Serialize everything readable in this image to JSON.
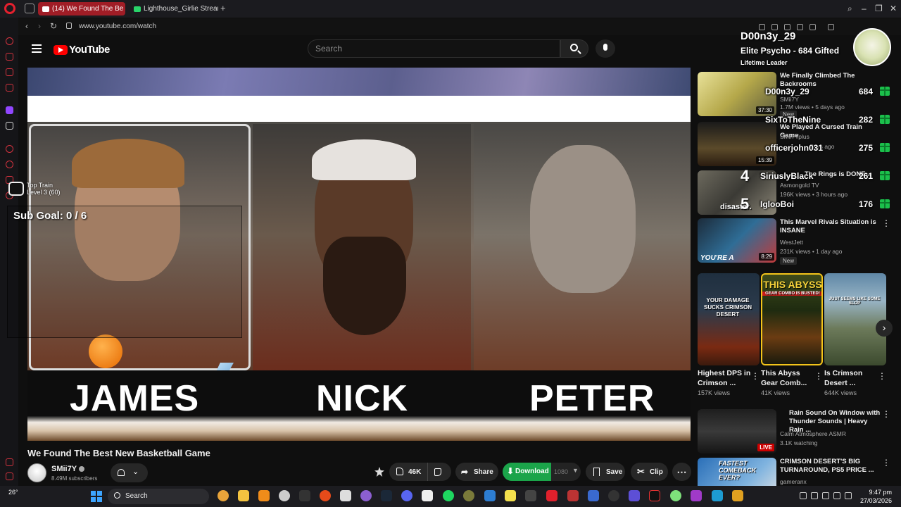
{
  "browser": {
    "tabs": [
      {
        "label": "(14) We Found The Be",
        "active": true
      },
      {
        "label": "Lighthouse_Girlie Stream",
        "active": false
      }
    ],
    "url": "www.youtube.com/watch"
  },
  "youtube": {
    "logo_text": "YouTube",
    "search_placeholder": "Search"
  },
  "video": {
    "title": "We Found The Best New Basketball Game",
    "players": [
      "JAMES",
      "NICK",
      "PETER"
    ],
    "overlay": {
      "train_title": "Top Train",
      "train_level": "Level 3 (60)",
      "sub_goal": "Sub Goal: 0 / 6"
    }
  },
  "channel": {
    "name": "SMii7Y",
    "subscribers": "8.49M subscribers"
  },
  "actions": {
    "likes": "46K",
    "share": "Share",
    "download": "Download",
    "resolution": "1080",
    "save": "Save",
    "clip": "Clip"
  },
  "leaderboard": {
    "top_user": "D00n3y_29",
    "top_title": "Elite Psycho - 684 Gifted",
    "top_subtitle": "Lifetime Leader",
    "entries": [
      {
        "rank": "",
        "user": "D00n3y_29",
        "value": "684"
      },
      {
        "rank": "",
        "user": "SixToTheNine",
        "value": "282"
      },
      {
        "rank": "",
        "user": "officerjohn031",
        "value": "275"
      },
      {
        "rank": "4",
        "user": "SiriuslyBlack",
        "value": "261"
      },
      {
        "rank": "5",
        "user": "IglooBoi",
        "value": "176"
      }
    ]
  },
  "recommendations": [
    {
      "title": "We Finally Climbed The Backrooms",
      "channel": "SMii7Y",
      "meta": "1.7M views • 5 days ago",
      "duration": "37:30",
      "badge": "New"
    },
    {
      "title": "We Played A Cursed Train Game",
      "channel": "SMii7Yplus",
      "meta": "days ago",
      "duration": "15:39",
      "badge": ""
    },
    {
      "title": "The Rings is DONE...",
      "channel": "Asmongold TV",
      "meta": "196K views • 3 hours ago",
      "duration": "",
      "badge": ""
    },
    {
      "title": "This Marvel Rivals Situation is INSANE",
      "channel": "WestJett",
      "meta": "231K views • 1 day ago",
      "duration": "8:29",
      "badge": "New"
    },
    {
      "title": "Rain Sound On Window with Thunder Sounds | Heavy Rain ...",
      "channel": "Calm Atmosphere ASMR",
      "meta": "3.1K watching",
      "duration": "",
      "live": "LIVE",
      "badge": ""
    },
    {
      "title": "CRIMSON DESERT'S BIG TURNAROUND, PS5 PRICE ...",
      "channel": "gameranx",
      "meta": "",
      "duration": "",
      "badge": ""
    }
  ],
  "thumb_captions": {
    "rec1": "disaster.",
    "rec4": "YOU'RE A",
    "rec6": "FASTEST COMEBACK EVER?"
  },
  "shorts": [
    {
      "title": "Highest DPS in Crimson ...",
      "views": "157K views",
      "caption": "YOUR DAMAGE SUCKS CRIMSON DESERT"
    },
    {
      "title": "This Abyss Gear Comb...",
      "views": "41K views",
      "caption": "THIS ABYSS",
      "subcaption": "GEAR COMBO IS BUSTED!"
    },
    {
      "title": "Is Crimson Desert ...",
      "views": "644K views",
      "caption": "JUST SEEMS LIKE SOME SLOP"
    }
  ],
  "taskbar": {
    "weather": "26°",
    "search": "Search",
    "time": "9:47 pm",
    "date": "27/03/2026"
  },
  "colors": {
    "accent_red": "#ff0000",
    "download_green": "#1ba44a",
    "gift_green": "#1bbf4b",
    "opera_red": "#e5202e"
  }
}
